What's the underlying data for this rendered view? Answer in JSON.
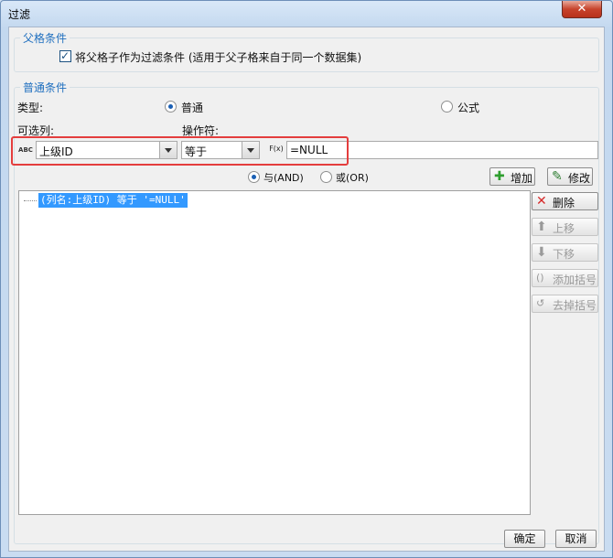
{
  "window": {
    "title": "过滤",
    "close_label": "✕"
  },
  "parent_group": {
    "label": "父格条件",
    "checkbox_checked": true,
    "checkbox_label": "将父格子作为过滤条件 (适用于父子格来自于同一个数据集)"
  },
  "normal_group": {
    "label": "普通条件"
  },
  "type_row": {
    "label": "类型:",
    "option_normal": "普通",
    "option_formula": "公式",
    "selected": "普通"
  },
  "column_label": "可选列:",
  "operator_label": "操作符:",
  "column_combo": {
    "value": "上级ID",
    "icon_text": "ABC"
  },
  "operator_combo": {
    "value": "等于"
  },
  "formula_icon_text": "F(x)",
  "value_input": {
    "value": "=NULL"
  },
  "logic": {
    "and_label": "与(AND)",
    "or_label": "或(OR)",
    "selected": "与(AND)"
  },
  "buttons": {
    "add": "增加",
    "modify": "修改",
    "delete": "删除",
    "move_up": "上移",
    "move_down": "下移",
    "add_bracket": "添加括号",
    "remove_bracket": "去掉括号",
    "ok": "确定",
    "cancel": "取消"
  },
  "conditions": [
    {
      "text": "(列名:上级ID) 等于 '=NULL'"
    }
  ],
  "colors": {
    "accent": "#1f6fbf",
    "highlight_border": "#e43d3d",
    "selection": "#3399ff",
    "add_icon": "#2e9e2e",
    "delete_icon": "#d62a2a"
  }
}
